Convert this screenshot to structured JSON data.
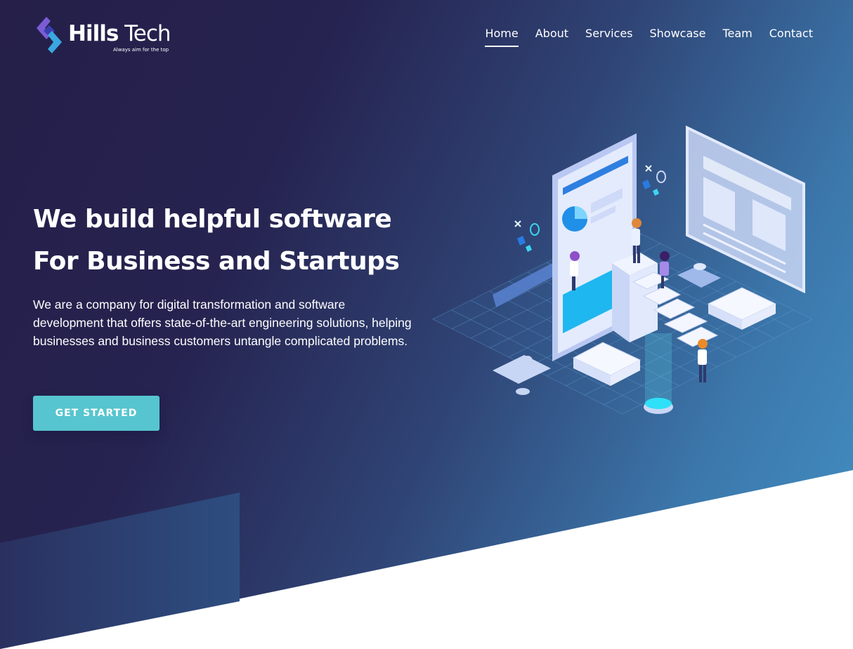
{
  "header": {
    "brand_name": "Hills Tech",
    "brand_name_bold": "Hills",
    "brand_name_light": "Tech",
    "tagline": "Always aim for the top",
    "nav": [
      {
        "label": "Home",
        "active": true
      },
      {
        "label": "About",
        "active": false
      },
      {
        "label": "Services",
        "active": false
      },
      {
        "label": "Showcase",
        "active": false
      },
      {
        "label": "Team",
        "active": false
      },
      {
        "label": "Contact",
        "active": false
      }
    ]
  },
  "hero": {
    "headline_line1": "We build helpful software",
    "headline_line2": "For Business and Startups",
    "description": "We are a company for digital transformation and software development that offers state-of-the-art engineering solutions, helping businesses and business customers untangle complicated problems.",
    "cta_label": "GET STARTED"
  },
  "colors": {
    "hero_dark": "#251f49",
    "hero_light": "#4391c4",
    "accent_teal": "#56c5cf",
    "text_white": "#ffffff"
  },
  "icons": {
    "logo": "chevron-logo-icon",
    "illustration": "isometric-app-development-illustration"
  }
}
